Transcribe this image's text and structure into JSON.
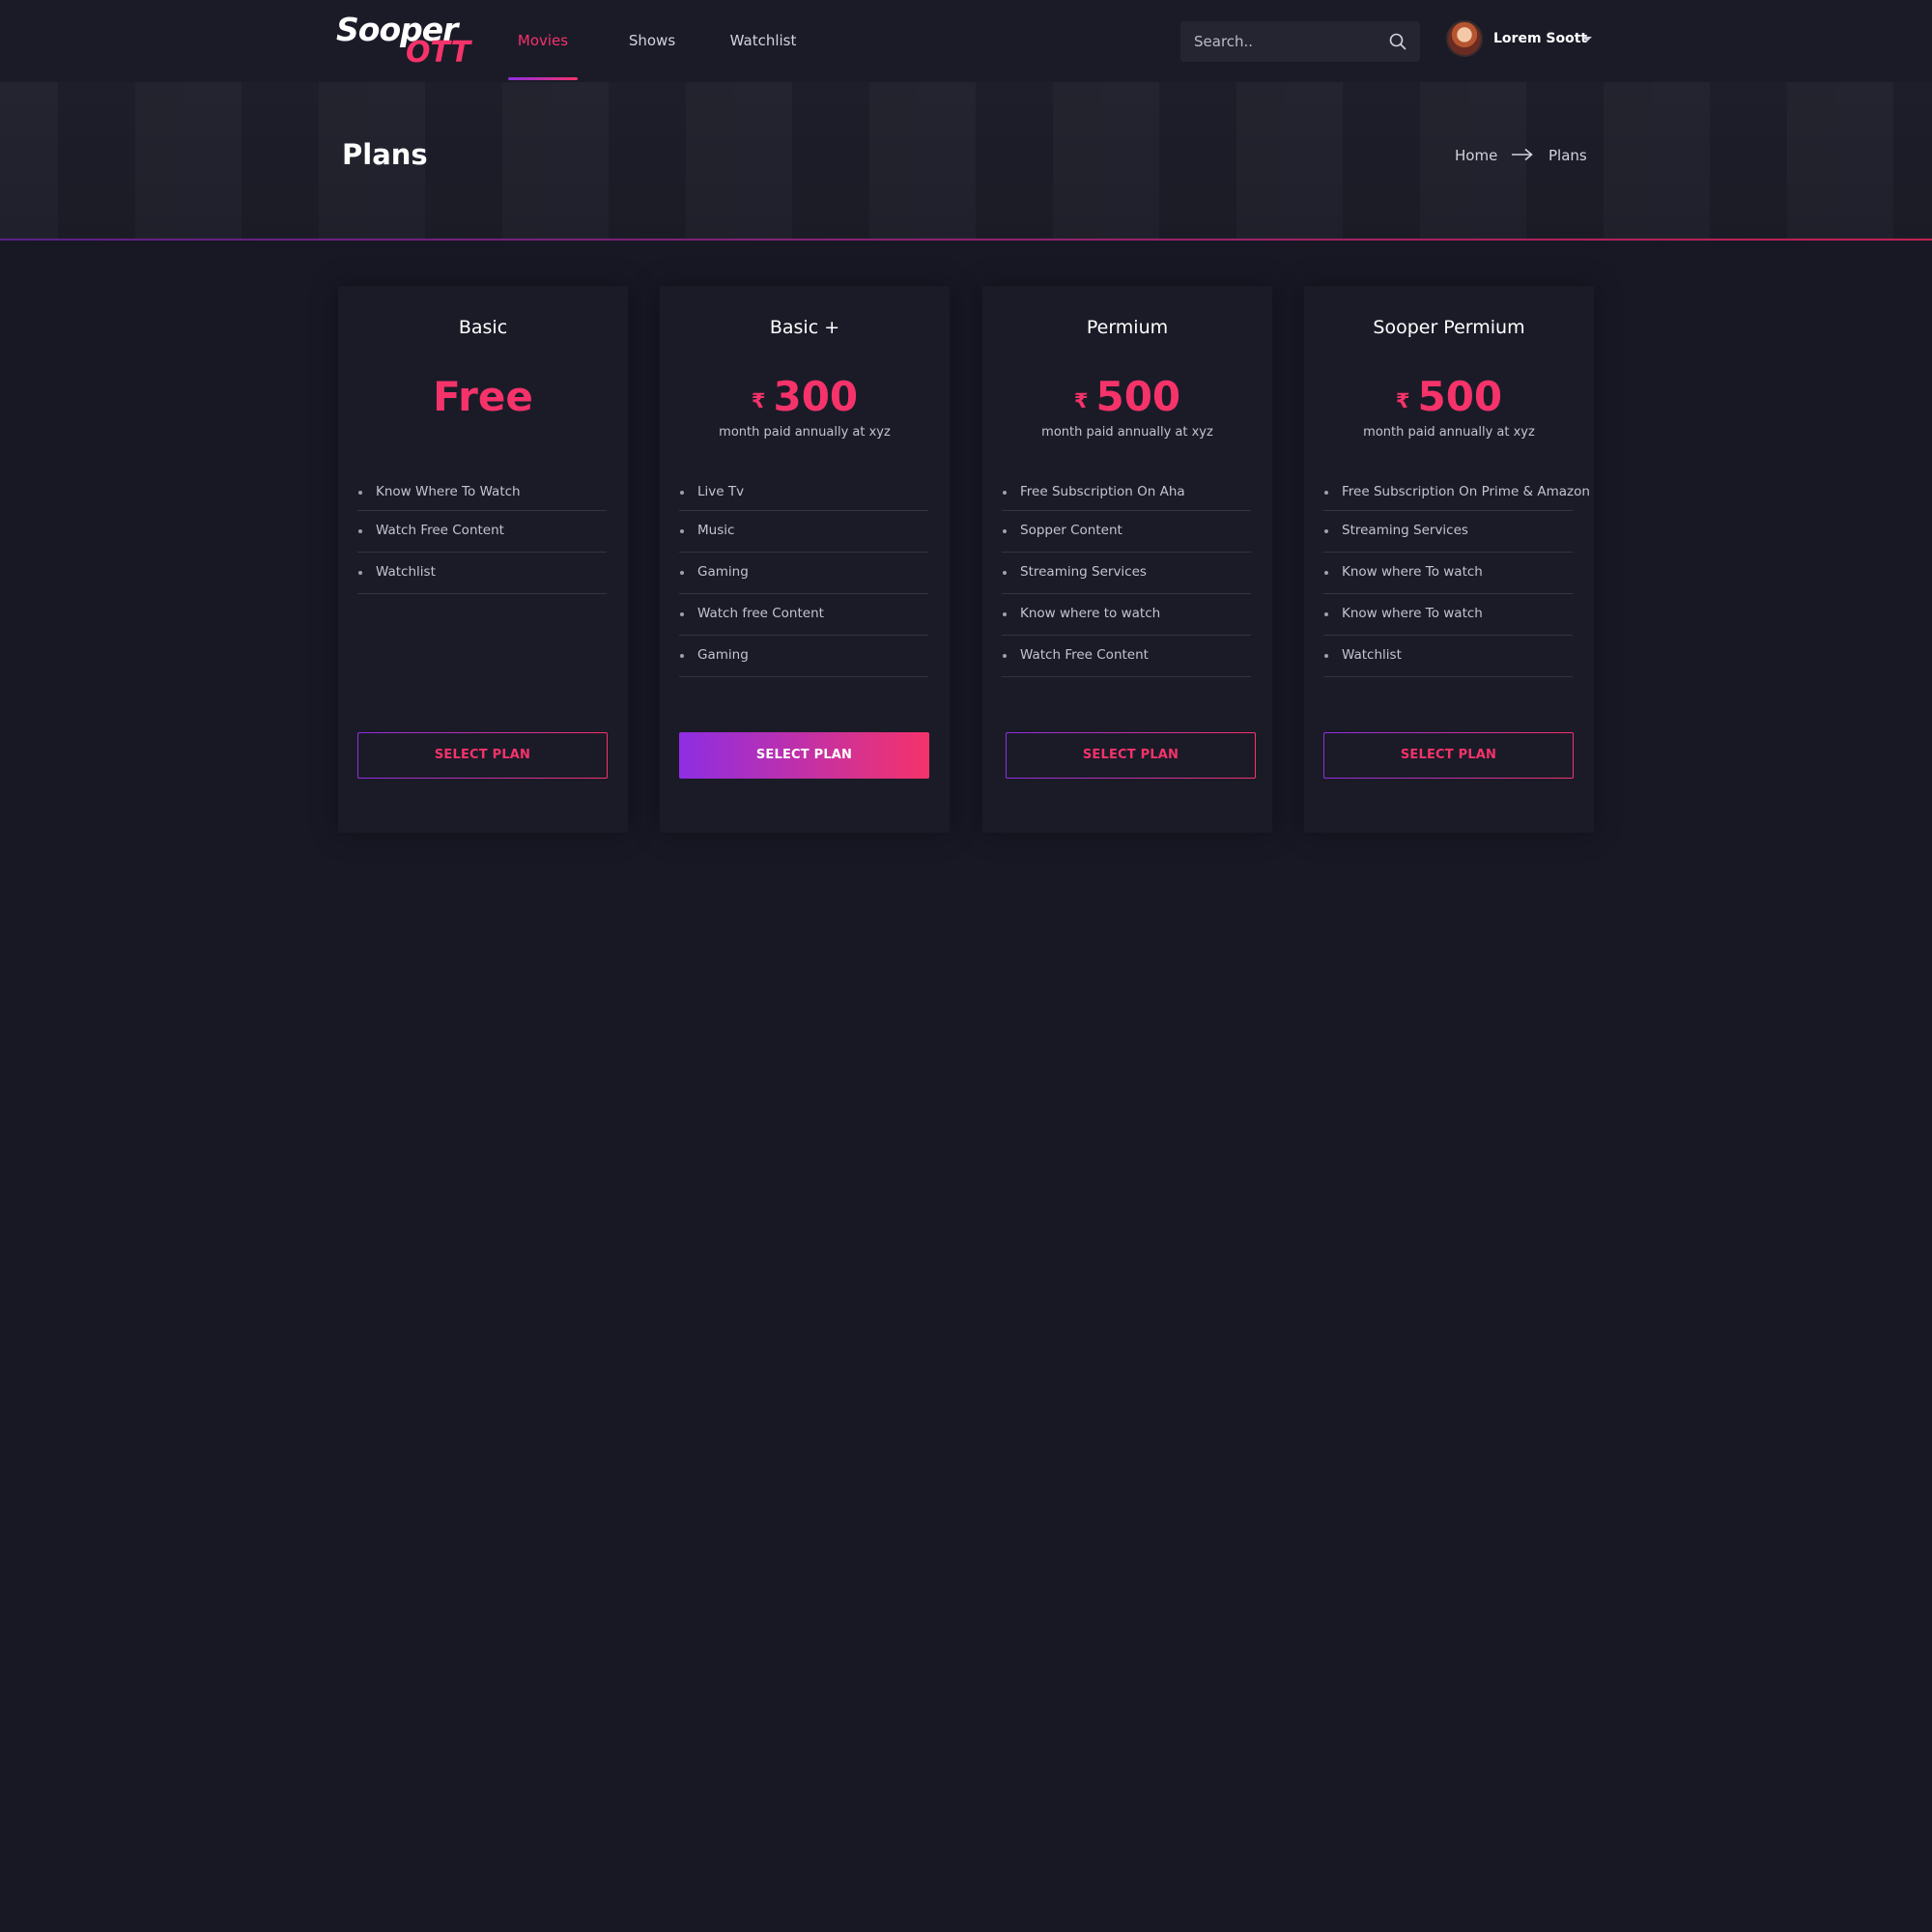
{
  "brand": {
    "logo_main": "Sooper",
    "logo_sub": "OTT"
  },
  "nav": [
    {
      "label": "Movies",
      "active": true
    },
    {
      "label": "Shows",
      "active": false
    },
    {
      "label": "Watchlist",
      "active": false
    }
  ],
  "search": {
    "placeholder": "Search..",
    "icon": "search-icon"
  },
  "user": {
    "name": "Lorem Soott",
    "icon": "chevron-down-icon"
  },
  "banner": {
    "title": "Plans",
    "breadcrumb": {
      "home": "Home",
      "current": "Plans"
    }
  },
  "colors": {
    "accent": "#f5336a",
    "accent_purple": "#8e2ee3",
    "background": "#181825",
    "card": "#1b1b28"
  },
  "plans": [
    {
      "name": "Basic",
      "currency": "",
      "price": "Free",
      "note": "",
      "features": [
        "Know Where To Watch",
        "Watch Free Content",
        "Watchlist"
      ],
      "button": "SELECT PLAN",
      "highlighted": false
    },
    {
      "name": "Basic +",
      "currency": "₹",
      "price": "300",
      "note": "month paid annually at xyz",
      "features": [
        "Live Tv",
        "Music",
        "Gaming",
        "Watch free Content",
        "Gaming"
      ],
      "button": "SELECT PLAN",
      "highlighted": true
    },
    {
      "name": "Permium",
      "currency": "₹",
      "price": "500",
      "note": "month paid annually at xyz",
      "features": [
        "Free Subscription On Aha",
        "Sopper Content",
        "Streaming Services",
        "Know where to watch",
        "Watch Free Content"
      ],
      "button": "SELECT PLAN",
      "highlighted": false
    },
    {
      "name": "Sooper Permium",
      "currency": "₹",
      "price": "500",
      "note": "month paid annually at xyz",
      "features": [
        "Free Subscription On Prime & Amazon",
        "Streaming Services",
        "Know where To watch",
        "Know where To watch",
        "Watchlist"
      ],
      "button": "SELECT PLAN",
      "highlighted": false
    }
  ]
}
